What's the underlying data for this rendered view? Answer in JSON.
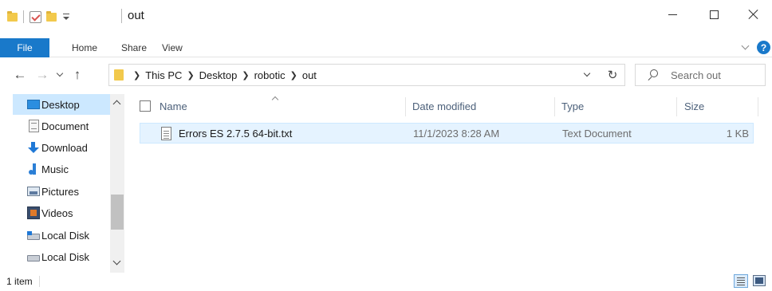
{
  "window": {
    "title": "out",
    "icons": [
      "folder-icon",
      "properties-check-icon",
      "new-folder-icon",
      "customize-qat-icon"
    ],
    "controls": {
      "minimize": "minimize-icon",
      "maximize": "maximize-icon",
      "close": "close-icon"
    }
  },
  "ribbon": {
    "tabs": [
      {
        "label": "File",
        "active": true,
        "color": "#1979ca"
      },
      {
        "label": "Home"
      },
      {
        "label": "Share"
      },
      {
        "label": "View"
      }
    ],
    "help_label": "?"
  },
  "navigation": {
    "back_icon": "arrow-left-icon",
    "forward_icon": "arrow-right-icon",
    "recent_icon": "chevron-down-icon",
    "up_icon": "arrow-up-icon",
    "breadcrumb": [
      "This PC",
      "Desktop",
      "robotic",
      "out"
    ],
    "search_placeholder": "Search out"
  },
  "sidebar": {
    "items": [
      {
        "label": "Desktop",
        "icon": "desktop-icon",
        "selected": true
      },
      {
        "label": "Document",
        "icon": "documents-icon"
      },
      {
        "label": "Download",
        "icon": "downloads-icon"
      },
      {
        "label": "Music",
        "icon": "music-icon"
      },
      {
        "label": "Pictures",
        "icon": "pictures-icon"
      },
      {
        "label": "Videos",
        "icon": "videos-icon"
      },
      {
        "label": "Local Disk",
        "icon": "local-disk-windows-icon"
      },
      {
        "label": "Local Disk",
        "icon": "local-disk-icon"
      }
    ]
  },
  "file_list": {
    "columns": [
      "Name",
      "Date modified",
      "Type",
      "Size"
    ],
    "rows": [
      {
        "name": "Errors ES 2.7.5 64-bit.txt",
        "date_modified": "11/1/2023 8:28 AM",
        "type": "Text Document",
        "size": "1 KB",
        "icon": "text-file-icon"
      }
    ]
  },
  "status": {
    "item_count": "1 item",
    "view_icons": [
      "details-view-icon",
      "large-icons-view-icon"
    ]
  },
  "colors": {
    "accent": "#1979ca",
    "selection": "#cce8ff",
    "row_hover": "#e5f3ff",
    "header_text": "#4c607a"
  }
}
